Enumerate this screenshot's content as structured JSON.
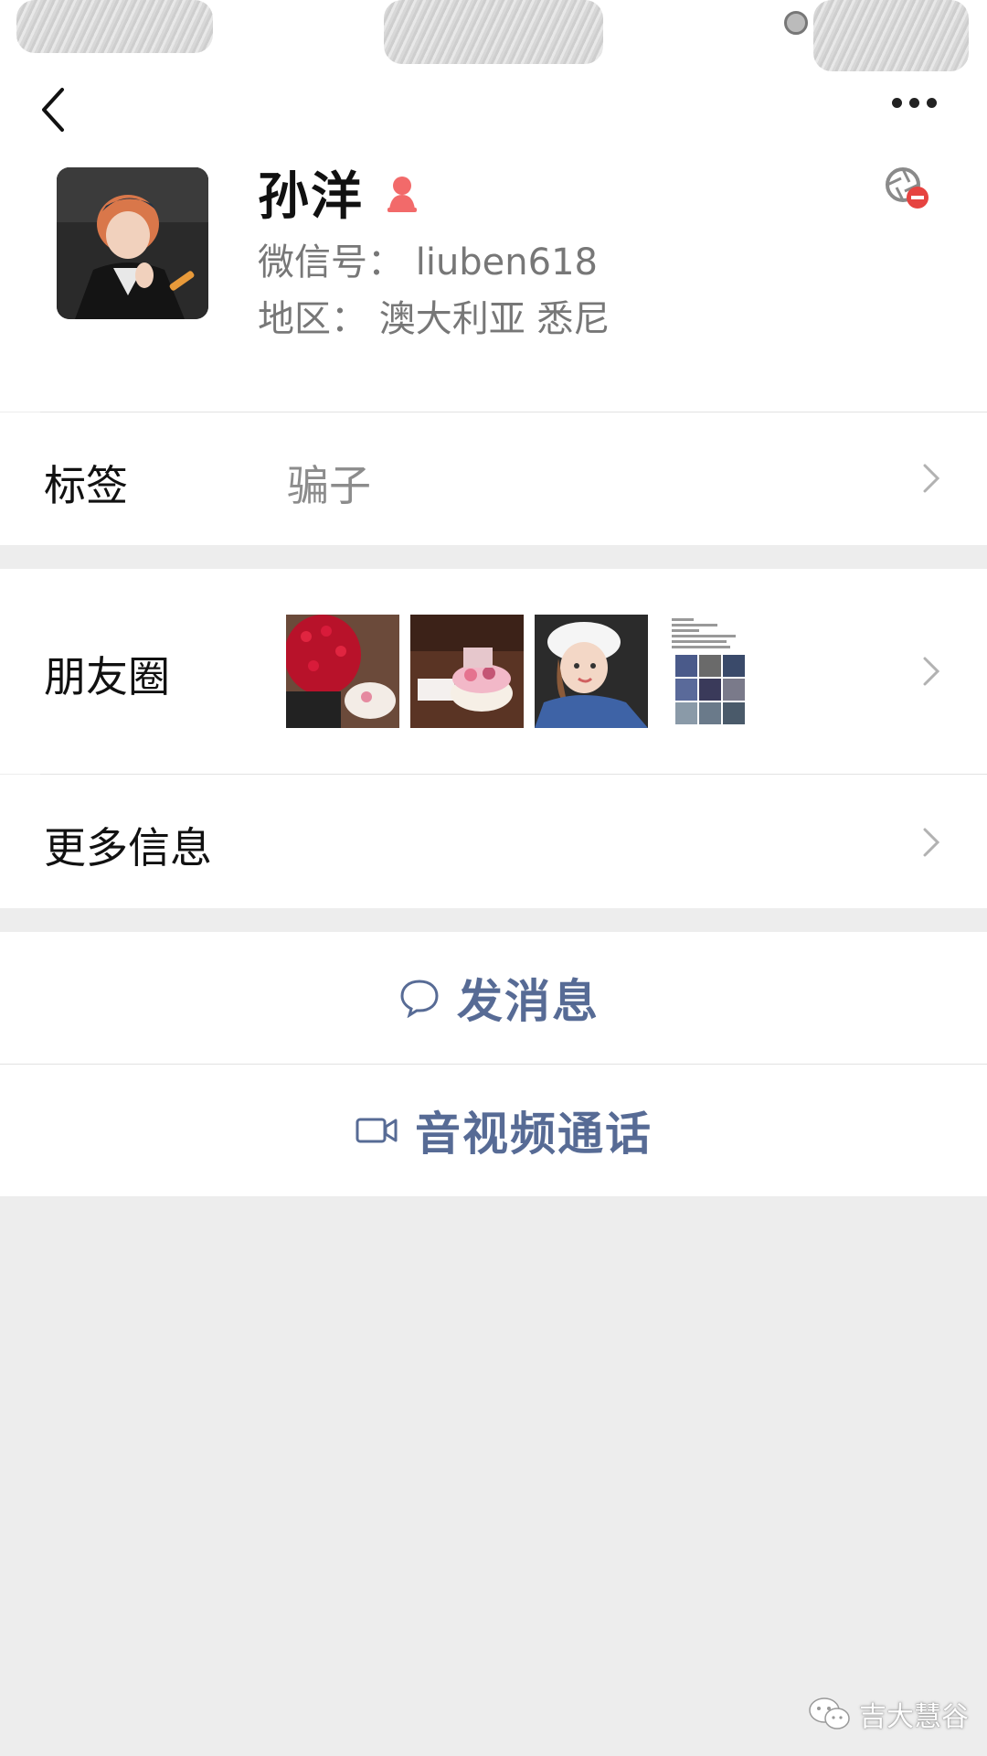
{
  "profile": {
    "name": "孙洋",
    "wechat_id": "微信号： liuben618",
    "region": "地区： 澳大利亚 悉尼"
  },
  "tag_row": {
    "label": "标签",
    "value": "骗子"
  },
  "moments_row": {
    "label": "朋友圈"
  },
  "more_info_row": {
    "label": "更多信息"
  },
  "actions": {
    "message": "发消息",
    "call": "音视频通话"
  },
  "watermark": {
    "text": "吉大慧谷"
  },
  "colors": {
    "link_blue": "#576b95",
    "background": "#ededed",
    "female_icon": "#f26a6a",
    "blocked_badge": "#e64340"
  }
}
